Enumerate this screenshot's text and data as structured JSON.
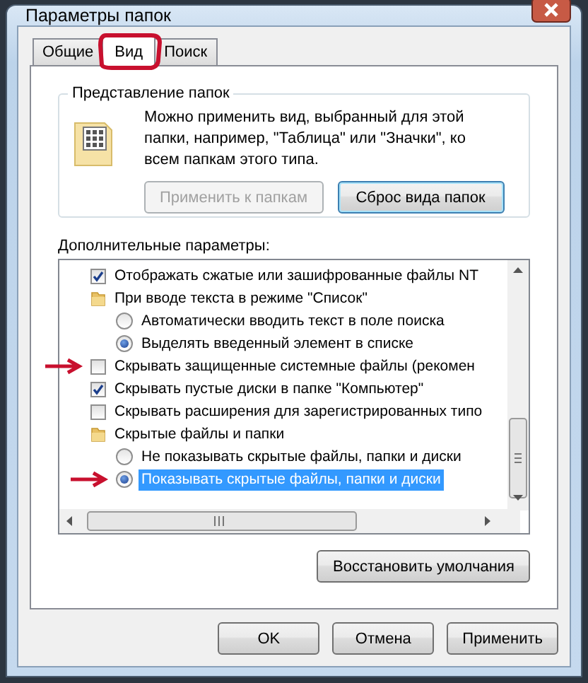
{
  "window": {
    "title": "Параметры папок"
  },
  "tabs": [
    {
      "label": "Общие",
      "selected": false,
      "circled": false
    },
    {
      "label": "Вид",
      "selected": true,
      "circled": true
    },
    {
      "label": "Поиск",
      "selected": false,
      "circled": false
    }
  ],
  "folder_views": {
    "title": "Представление папок",
    "description": "Можно применить вид, выбранный для этой папки, например, \"Таблица\" или \"Значки\", ко всем папкам этого типа.",
    "buttons": [
      {
        "label": "Применить к папкам",
        "disabled": true,
        "focused": false
      },
      {
        "label": "Сброс вида папок",
        "disabled": false,
        "focused": true
      }
    ]
  },
  "advanced": {
    "label": "Дополнительные параметры:",
    "items": [
      {
        "kind": "checkbox",
        "label": "Отображать сжатые или зашифрованные файлы NT",
        "checked": true,
        "selected": false,
        "arrow": false
      },
      {
        "kind": "folder",
        "label": "При вводе текста в режиме \"Список\"",
        "selected": false,
        "arrow": false,
        "children": [
          {
            "kind": "radio",
            "label": "Автоматически вводить текст в поле поиска",
            "checked": false,
            "selected": false,
            "arrow": false
          },
          {
            "kind": "radio",
            "label": "Выделять введенный элемент в списке",
            "checked": true,
            "selected": false,
            "arrow": false
          }
        ]
      },
      {
        "kind": "checkbox",
        "label": "Скрывать защищенные системные файлы (рекомен",
        "checked": false,
        "selected": false,
        "arrow": true
      },
      {
        "kind": "checkbox",
        "label": "Скрывать пустые диски в папке \"Компьютер\"",
        "checked": true,
        "selected": false,
        "arrow": false
      },
      {
        "kind": "checkbox",
        "label": "Скрывать расширения для зарегистрированных типо",
        "checked": false,
        "selected": false,
        "arrow": false
      },
      {
        "kind": "folder",
        "label": "Скрытые файлы и папки",
        "selected": false,
        "arrow": false,
        "children": [
          {
            "kind": "radio",
            "label": "Не показывать скрытые файлы, папки и диски",
            "checked": false,
            "selected": false,
            "arrow": false
          },
          {
            "kind": "radio",
            "label": "Показывать скрытые файлы, папки и диски",
            "checked": true,
            "selected": true,
            "arrow": true
          }
        ]
      }
    ]
  },
  "restore_button": {
    "label": "Восстановить умолчания"
  },
  "dialog_buttons": [
    {
      "label": "OK"
    },
    {
      "label": "Отмена"
    },
    {
      "label": "Применить"
    }
  ]
}
